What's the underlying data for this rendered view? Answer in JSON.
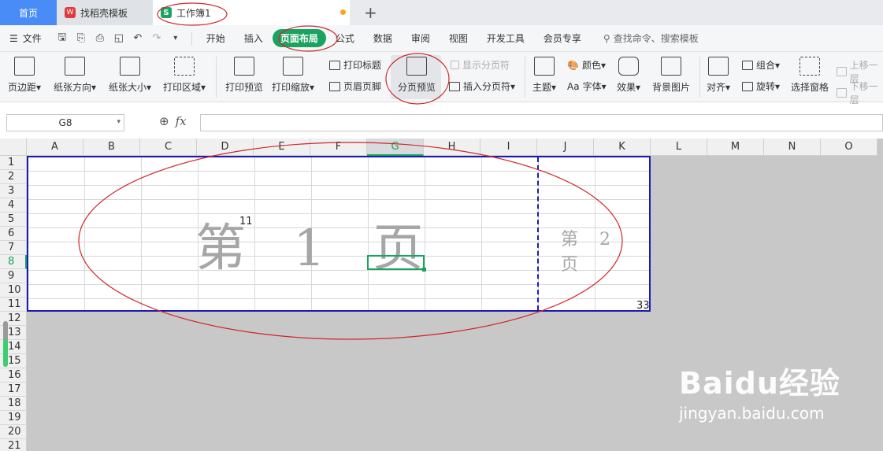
{
  "tabs": {
    "home": "首页",
    "templates": "找稻壳模板",
    "workbook": "工作簿1",
    "new": "+",
    "template_logo": "W",
    "workbook_logo": "S"
  },
  "menu": {
    "file": "文件",
    "items": [
      "开始",
      "插入",
      "页面布局",
      "公式",
      "数据",
      "审阅",
      "视图",
      "开发工具",
      "会员专享"
    ],
    "active": "页面布局",
    "search": "查找命令、搜索模板"
  },
  "ribbon": {
    "margins": "页边距",
    "orientation": "纸张方向",
    "size": "纸张大小",
    "print_area": "打印区域",
    "print_preview": "打印预览",
    "print_scale": "打印缩放",
    "print_titles": "打印标题",
    "header_footer": "页眉页脚",
    "page_break_preview": "分页预览",
    "show_page_breaks": "显示分页符",
    "insert_page_break": "插入分页符",
    "theme": "主题",
    "colors": "颜色",
    "fonts": "字体",
    "effects": "效果",
    "background": "背景图片",
    "align": "对齐",
    "group": "组合",
    "rotate": "旋转",
    "selection_pane": "选择窗格",
    "bring_forward": "上移一层",
    "send_backward": "下移一层"
  },
  "formula_bar": {
    "name_box": "G8",
    "fx": "fx"
  },
  "sheet": {
    "columns": [
      "A",
      "B",
      "C",
      "D",
      "E",
      "F",
      "G",
      "H",
      "I",
      "J",
      "K",
      "L",
      "M",
      "N",
      "O"
    ],
    "selected_column": "G",
    "rows": [
      "1",
      "2",
      "3",
      "4",
      "5",
      "6",
      "7",
      "8",
      "9",
      "10",
      "11",
      "12",
      "13",
      "14",
      "15",
      "16",
      "17",
      "18",
      "19",
      "20",
      "21"
    ],
    "selected_row": "8",
    "page1_label": "第 1 页",
    "page2_label": "第 2 页",
    "cell_d5": "11",
    "cell_k11": "33"
  },
  "watermark": {
    "brand": "Baidu经验",
    "url": "jingyan.baidu.com"
  },
  "colors": {
    "accent": "#1aa261",
    "home_tab": "#4a8cf7",
    "page_border": "#1a1ab4",
    "annotation": "#d0262b"
  }
}
